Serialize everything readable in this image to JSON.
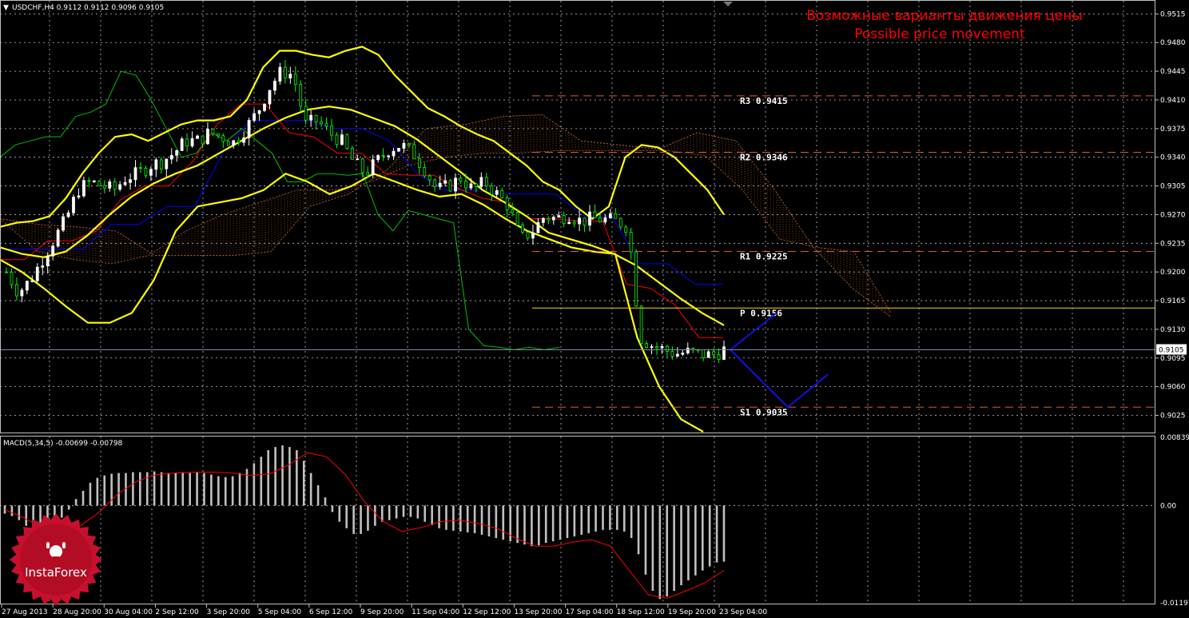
{
  "header": {
    "symbol_info": "USDCHF,H4  0.9112 0.9112 0.9096 0.9105",
    "macd_info": "MACD(5,34,5) -0.00699 -0.00798"
  },
  "annotation": {
    "title_ru": "Возможные варианты движения цены",
    "title_en": "Possible price movement"
  },
  "logo": {
    "text": "InstaForex"
  },
  "colors": {
    "background": "#000000",
    "grid": "#c0c0c0",
    "bull_candle": "#ffffff",
    "bear_candle": "#00ff00",
    "bollinger": "#ffff00",
    "kijun": "#0000ff",
    "tenkan": "#ff0000",
    "chikou": "#00c000",
    "cloud": "#d2691e",
    "pivot_line": "#ffd700",
    "sr_line": "#e05a28",
    "forecast": "#1010e0",
    "macd_hist": "#c0c0c0",
    "macd_signal": "#ff0000",
    "annotation_text": "#ff0000",
    "logo": "#c8102e"
  },
  "chart_data": [
    {
      "type": "candlestick",
      "symbol": "USDCHF",
      "timeframe": "H4",
      "ylim": [
        0.9005,
        0.953
      ],
      "y_ticks": [
        "0.9515",
        "0.9480",
        "0.9445",
        "0.9410",
        "0.9375",
        "0.9340",
        "0.9305",
        "0.9270",
        "0.9235",
        "0.9200",
        "0.9165",
        "0.9130",
        "0.9095",
        "0.9060",
        "0.9025"
      ],
      "current_price": {
        "value": 0.9105,
        "label": "0.9105"
      },
      "x_tick_labels": [
        "27 Aug 2013",
        "28 Aug 20:00",
        "30 Aug 04:00",
        "2 Sep 12:00",
        "3 Sep 20:00",
        "5 Sep 04:00",
        "6 Sep 12:00",
        "9 Sep 20:00",
        "11 Sep 04:00",
        "12 Sep 12:00",
        "13 Sep 20:00",
        "17 Sep 04:00",
        "18 Sep 12:00",
        "19 Sep 20:00",
        "23 Sep 04:00"
      ],
      "levels": [
        {
          "name": "R3",
          "label": "R3  0.9415",
          "value": 0.9415,
          "style": "dashed"
        },
        {
          "name": "R2",
          "label": "R2  0.9346",
          "value": 0.9346,
          "style": "dashed"
        },
        {
          "name": "R1",
          "label": "R1  0.9225",
          "value": 0.9225,
          "style": "dashed"
        },
        {
          "name": "P",
          "label": "P  0.9156",
          "value": 0.9156,
          "style": "solid"
        },
        {
          "name": "S1",
          "label": "S1  0.9035",
          "value": 0.9035,
          "style": "dashed"
        }
      ],
      "close_path": [
        0.92,
        0.9175,
        0.919,
        0.9215,
        0.924,
        0.9265,
        0.93,
        0.931,
        0.9305,
        0.93,
        0.9315,
        0.932,
        0.933,
        0.9335,
        0.9345,
        0.936,
        0.936,
        0.937,
        0.9365,
        0.9358,
        0.9375,
        0.9395,
        0.9425,
        0.9445,
        0.944,
        0.938,
        0.9385,
        0.937,
        0.936,
        0.9335,
        0.932,
        0.9335,
        0.935,
        0.9355,
        0.9345,
        0.9325,
        0.93,
        0.9305,
        0.9315,
        0.93,
        0.931,
        0.9295,
        0.928,
        0.924,
        0.925,
        0.9268,
        0.9265,
        0.927,
        0.9262,
        0.9265,
        0.9264,
        0.9262,
        0.9255,
        0.912,
        0.911,
        0.9105,
        0.91,
        0.9102,
        0.91,
        0.9098,
        0.9105
      ],
      "bollinger_upper": [
        0.9255,
        0.926,
        0.9262,
        0.9268,
        0.929,
        0.932,
        0.9345,
        0.9365,
        0.9368,
        0.936,
        0.937,
        0.938,
        0.9385,
        0.9385,
        0.939,
        0.941,
        0.945,
        0.947,
        0.947,
        0.9465,
        0.9462,
        0.947,
        0.9475,
        0.9465,
        0.944,
        0.942,
        0.94,
        0.939,
        0.9378,
        0.9368,
        0.936,
        0.9345,
        0.933,
        0.931,
        0.93,
        0.928,
        0.9265,
        0.928,
        0.934,
        0.9355,
        0.9352,
        0.934,
        0.932,
        0.93,
        0.927
      ],
      "bollinger_middle": [
        0.923,
        0.9222,
        0.9218,
        0.9225,
        0.9245,
        0.927,
        0.9292,
        0.9308,
        0.932,
        0.933,
        0.9345,
        0.936,
        0.9375,
        0.9388,
        0.9398,
        0.9402,
        0.9398,
        0.9388,
        0.9378,
        0.9362,
        0.9342,
        0.9322,
        0.93,
        0.9285,
        0.9268,
        0.9248,
        0.924,
        0.9232,
        0.9222,
        0.9208,
        0.9188,
        0.9168,
        0.915,
        0.9135
      ],
      "bollinger_lower": [
        0.9215,
        0.92,
        0.918,
        0.9158,
        0.9138,
        0.9138,
        0.915,
        0.919,
        0.925,
        0.928,
        0.9285,
        0.929,
        0.93,
        0.932,
        0.931,
        0.9295,
        0.9305,
        0.932,
        0.931,
        0.93,
        0.9292,
        0.9295,
        0.9282,
        0.9265,
        0.925,
        0.924,
        0.923,
        0.9225,
        0.9222,
        0.912,
        0.906,
        0.902,
        0.9005
      ],
      "kijun": [
        0.9228,
        0.9228,
        0.9228,
        0.9228,
        0.9258,
        0.9258,
        0.928,
        0.928,
        0.9345,
        0.9385,
        0.9385,
        0.9385,
        0.9375,
        0.9375,
        0.936,
        0.932,
        0.93,
        0.93,
        0.9295,
        0.9295,
        0.9295,
        0.9268,
        0.9268,
        0.921,
        0.921,
        0.9185,
        0.9185
      ],
      "tenkan": [
        0.9215,
        0.9215,
        0.9238,
        0.9238,
        0.925,
        0.9288,
        0.9305,
        0.9305,
        0.9335,
        0.938,
        0.9405,
        0.9405,
        0.937,
        0.9365,
        0.9345,
        0.9345,
        0.932,
        0.9318,
        0.9318,
        0.9302,
        0.929,
        0.9285,
        0.9265,
        0.9265,
        0.9262,
        0.9262,
        0.9185,
        0.918,
        0.916,
        0.912,
        0.912
      ],
      "senkou_a": [
        0.9265,
        0.9258,
        0.9255,
        0.925,
        0.922,
        0.922,
        0.922,
        0.9225,
        0.928,
        0.9295,
        0.9325,
        0.9375,
        0.938,
        0.939,
        0.9392,
        0.936,
        0.9355,
        0.935,
        0.937,
        0.936,
        0.93,
        0.923,
        0.918,
        0.9145
      ],
      "senkou_b": [
        0.9265,
        0.9225,
        0.9215,
        0.921,
        0.922,
        0.925,
        0.927,
        0.9285,
        0.93,
        0.93,
        0.931,
        0.933,
        0.934,
        0.9345,
        0.9345,
        0.9348,
        0.9348,
        0.9348,
        0.9348,
        0.9342,
        0.93,
        0.924,
        0.923,
        0.9225,
        0.915
      ],
      "chikou": [
        0.934,
        0.9355,
        0.936,
        0.9365,
        0.9365,
        0.939,
        0.9395,
        0.9405,
        0.9445,
        0.944,
        0.941,
        0.9375,
        0.934,
        0.9345,
        0.937,
        0.936,
        0.9375,
        0.936,
        0.9345,
        0.931,
        0.931,
        0.932,
        0.932,
        0.9318,
        0.932,
        0.927,
        0.925,
        0.9275,
        0.927,
        0.9265,
        0.926,
        0.913,
        0.911,
        0.9108,
        0.9105,
        0.9108,
        0.9105,
        0.9108
      ],
      "forecast_up": [
        0.9105,
        0.915
      ],
      "forecast_down": [
        0.9105,
        0.9035,
        0.9075
      ]
    },
    {
      "type": "bar",
      "name": "MACD(5,34,5)",
      "main": -0.00699,
      "signal": -0.00798,
      "ylim": [
        -0.01197,
        0.00839
      ],
      "y_ticks": [
        "0.00839",
        "0.00",
        "-0.01197"
      ],
      "histogram": [
        -0.001,
        -0.0013,
        -0.0018,
        -0.0025,
        -0.003,
        -0.0032,
        -0.003,
        -0.0024,
        -0.0015,
        -0.0005,
        0.0008,
        0.0018,
        0.0028,
        0.0034,
        0.0037,
        0.0039,
        0.004,
        0.004,
        0.0041,
        0.0041,
        0.0041,
        0.0042,
        0.0041,
        0.004,
        0.004,
        0.0041,
        0.004,
        0.0041,
        0.004,
        0.0038,
        0.0036,
        0.0035,
        0.0036,
        0.004,
        0.0045,
        0.0052,
        0.006,
        0.0068,
        0.0072,
        0.0074,
        0.0072,
        0.0068,
        0.0055,
        0.004,
        0.0025,
        0.001,
        -0.0008,
        -0.002,
        -0.0028,
        -0.0035,
        -0.0035,
        -0.0031,
        -0.0025,
        -0.002,
        -0.0018,
        -0.0016,
        -0.0014,
        -0.0014,
        -0.0016,
        -0.002,
        -0.0024,
        -0.0028,
        -0.003,
        -0.0031,
        -0.0032,
        -0.0033,
        -0.0034,
        -0.0036,
        -0.0038,
        -0.004,
        -0.0042,
        -0.0044,
        -0.0046,
        -0.0048,
        -0.005,
        -0.0049,
        -0.0046,
        -0.0044,
        -0.0042,
        -0.004,
        -0.0038,
        -0.0036,
        -0.0034,
        -0.0032,
        -0.003,
        -0.003,
        -0.003,
        -0.0032,
        -0.004,
        -0.006,
        -0.0085,
        -0.0105,
        -0.0115,
        -0.0112,
        -0.0105,
        -0.0098,
        -0.0092,
        -0.0086,
        -0.008,
        -0.0075,
        -0.007,
        -0.0069
      ],
      "signal_line": [
        -0.0005,
        -0.0015,
        -0.0028,
        -0.0032,
        -0.0025,
        -0.0008,
        0.0015,
        0.003,
        0.0038,
        0.004,
        0.0041,
        0.0041,
        0.004,
        0.0037,
        0.0039,
        0.005,
        0.0065,
        0.006,
        0.0038,
        0.0005,
        -0.002,
        -0.0032,
        -0.0027,
        -0.002,
        -0.0018,
        -0.0022,
        -0.0028,
        -0.004,
        -0.005,
        -0.005,
        -0.0045,
        -0.0042,
        -0.005,
        -0.008,
        -0.011,
        -0.0114,
        -0.0105,
        -0.0095,
        -0.008
      ]
    }
  ]
}
